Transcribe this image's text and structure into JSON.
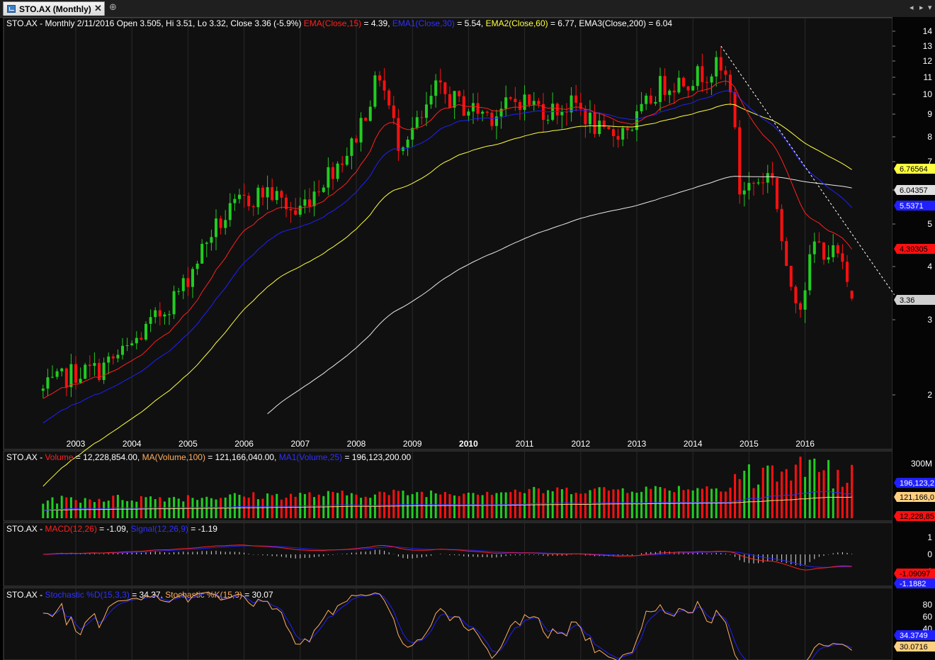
{
  "tab": {
    "label": "STO.AX (Monthly)",
    "close": "✕",
    "new_tab": "⊕"
  },
  "nav": {
    "left": "◂",
    "right": "▸",
    "menu": "▾"
  },
  "colors": {
    "up": "#22cc22",
    "down": "#ff1010",
    "ema15": "#ff2020",
    "ema30": "#2020ff",
    "ema60": "#ffff40",
    "ema200": "#e8e8e8",
    "trend": "#ffffff",
    "grid": "#2a2a2a",
    "panel_bg": "#101010"
  },
  "panels": {
    "price": {
      "title_parts": [
        {
          "text": "STO.AX - Monthly 2/11/2016 Open 3.505, Hi 3.51, Lo 3.32, Close 3.36 (-5.9%) ",
          "color": "#ffffff"
        },
        {
          "text": "EMA(Close,15)",
          "color": "#ff2020"
        },
        {
          "text": " = 4.39, ",
          "color": "#ffffff"
        },
        {
          "text": "EMA1(Close,30)",
          "color": "#3030ff"
        },
        {
          "text": " = 5.54, ",
          "color": "#ffffff"
        },
        {
          "text": "EMA2(Close,60)",
          "color": "#ffff40"
        },
        {
          "text": " = 6.77, EMA3(Close,200) = 6.04",
          "color": "#ffffff"
        }
      ],
      "y_ticks": [
        "14",
        "13",
        "12",
        "11",
        "10",
        "9",
        "8",
        "7",
        "6",
        "5",
        "4",
        "3",
        "2"
      ],
      "markers": [
        {
          "label": "6.76564",
          "value": 6.76564,
          "bg": "#ffff40",
          "fg": "#000000"
        },
        {
          "label": "6.04357",
          "value": 6.04357,
          "bg": "#e0e0e0",
          "fg": "#000000"
        },
        {
          "label": "5.5371",
          "value": 5.5371,
          "bg": "#2020ff",
          "fg": "#ffffff"
        },
        {
          "label": "4.39305",
          "value": 4.39305,
          "bg": "#ff1010",
          "fg": "#000000"
        },
        {
          "label": "3.36",
          "value": 3.36,
          "bg": "#d0d0d0",
          "fg": "#000000"
        }
      ],
      "x_labels": [
        "2003",
        "2004",
        "2005",
        "2006",
        "2007",
        "2008",
        "2009",
        "2010",
        "2011",
        "2012",
        "2013",
        "2014",
        "2015",
        "2016"
      ]
    },
    "volume": {
      "title_parts": [
        {
          "text": "STO.AX - ",
          "color": "#ffffff"
        },
        {
          "text": "Volume",
          "color": "#ff2020"
        },
        {
          "text": " = 12,228,854.00, ",
          "color": "#ffffff"
        },
        {
          "text": "MA(Volume,100)",
          "color": "#ffb060"
        },
        {
          "text": " = 121,166,040.00, ",
          "color": "#ffffff"
        },
        {
          "text": "MA1(Volume,25)",
          "color": "#3030ff"
        },
        {
          "text": " = 196,123,200.00",
          "color": "#ffffff"
        }
      ],
      "y_ticks": [
        "300M"
      ],
      "markers": [
        {
          "label": "196,123,2",
          "bg": "#2020ff",
          "fg": "#ffffff"
        },
        {
          "label": "121,166,0",
          "bg": "#ffd080",
          "fg": "#000000"
        },
        {
          "label": "12,228,85",
          "bg": "#ff1010",
          "fg": "#000000"
        }
      ]
    },
    "macd": {
      "title_parts": [
        {
          "text": "STO.AX - ",
          "color": "#ffffff"
        },
        {
          "text": "MACD(12,26)",
          "color": "#ff2020"
        },
        {
          "text": " = -1.09, ",
          "color": "#ffffff"
        },
        {
          "text": "Signal(12,26,9)",
          "color": "#3030ff"
        },
        {
          "text": " = -1.19",
          "color": "#ffffff"
        }
      ],
      "y_ticks": [
        "1",
        "0",
        "-1"
      ],
      "markers": [
        {
          "label": "-1.09097",
          "bg": "#ff1010",
          "fg": "#000000"
        },
        {
          "label": "-1.1882",
          "bg": "#2020ff",
          "fg": "#ffffff"
        }
      ]
    },
    "stoch": {
      "title_parts": [
        {
          "text": "STO.AX - ",
          "color": "#ffffff"
        },
        {
          "text": "Stochastic %D(15,3,3)",
          "color": "#3030ff"
        },
        {
          "text": " = 34.37, ",
          "color": "#ffffff"
        },
        {
          "text": "Stochastic %K(15,3)",
          "color": "#ffb060"
        },
        {
          "text": " = 30.07",
          "color": "#ffffff"
        }
      ],
      "y_ticks": [
        "80",
        "60",
        "40"
      ],
      "markers": [
        {
          "label": "34.3749",
          "bg": "#2020ff",
          "fg": "#ffffff"
        },
        {
          "label": "30.0716",
          "bg": "#ffd080",
          "fg": "#000000"
        }
      ]
    }
  },
  "chart_data": {
    "type": "candlestick",
    "symbol": "STO.AX",
    "period": "Monthly",
    "scale": "log",
    "ylim": [
      1.8,
      15
    ],
    "close_anchors": [
      [
        "2002-06",
        2.05
      ],
      [
        "2002-12",
        2.25
      ],
      [
        "2003-06",
        2.3
      ],
      [
        "2003-12",
        2.55
      ],
      [
        "2004-06",
        3.0
      ],
      [
        "2004-12",
        3.6
      ],
      [
        "2005-06",
        4.8
      ],
      [
        "2005-12",
        5.6
      ],
      [
        "2006-06",
        6.0
      ],
      [
        "2006-12",
        5.3
      ],
      [
        "2007-06",
        6.4
      ],
      [
        "2007-12",
        7.6
      ],
      [
        "2008-06",
        11.2
      ],
      [
        "2008-10",
        7.8
      ],
      [
        "2009-03",
        8.7
      ],
      [
        "2009-06",
        10.3
      ],
      [
        "2009-12",
        9.4
      ],
      [
        "2010-06",
        9.0
      ],
      [
        "2010-12",
        9.8
      ],
      [
        "2011-06",
        9.2
      ],
      [
        "2011-12",
        9.5
      ],
      [
        "2012-06",
        8.0
      ],
      [
        "2012-12",
        8.5
      ],
      [
        "2013-06",
        10.5
      ],
      [
        "2013-12",
        10.9
      ],
      [
        "2014-06",
        11.6
      ],
      [
        "2014-09",
        10.6
      ],
      [
        "2014-10",
        8.0
      ],
      [
        "2014-11",
        6.0
      ],
      [
        "2015-06",
        6.6
      ],
      [
        "2015-09",
        3.8
      ],
      [
        "2015-12",
        3.3
      ],
      [
        "2016-03",
        4.5
      ],
      [
        "2016-08",
        4.2
      ],
      [
        "2016-11",
        3.36
      ]
    ],
    "last_bar": {
      "date": "2/11/2016",
      "open": 3.505,
      "high": 3.51,
      "low": 3.32,
      "close": 3.36,
      "change_pct": -5.9
    },
    "series": [
      {
        "name": "EMA(Close,15)",
        "last": 4.39
      },
      {
        "name": "EMA1(Close,30)",
        "last": 5.54
      },
      {
        "name": "EMA2(Close,60)",
        "last": 6.77
      },
      {
        "name": "EMA3(Close,200)",
        "last": 6.04
      }
    ],
    "trendline": [
      [
        "2014-07",
        13.0
      ],
      [
        "2016-11",
        3.7
      ]
    ],
    "volume": {
      "last": 12228854.0,
      "ma100": 121166040.0,
      "ma25": 196123200.0
    },
    "macd": {
      "macd": -1.09,
      "signal": -1.19
    },
    "stochastic": {
      "d": 34.37,
      "k": 30.07
    }
  }
}
